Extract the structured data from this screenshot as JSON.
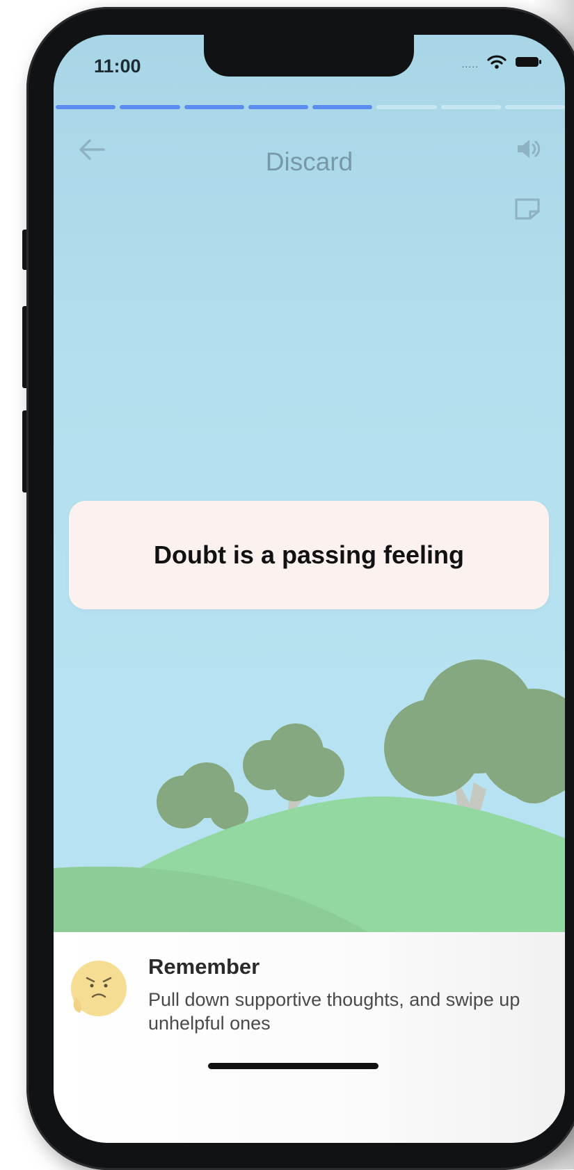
{
  "status_bar": {
    "time": "11:00",
    "signal_icon": "cellular-dots-icon",
    "wifi_icon": "wifi-icon",
    "battery_icon": "battery-icon"
  },
  "progress": {
    "total_steps": 8,
    "completed_steps": 5,
    "active_color": "#5b8df0",
    "inactive_color": "#c9e7f3"
  },
  "header": {
    "title": "Discard",
    "back_icon": "back-arrow-icon",
    "audio_icon": "speaker-icon",
    "note_icon": "note-icon"
  },
  "card": {
    "text": "Doubt is a passing feeling"
  },
  "remember": {
    "title": "Remember",
    "body": "Pull down supportive thoughts, and swipe up unhelpful ones",
    "avatar_icon": "worried-face-avatar"
  },
  "colors": {
    "sky": "#b7e2f1",
    "hill_back": "#8fd59a",
    "hill_front": "#94d99f",
    "tree": "#86a880",
    "trunk": "#c6c9bf",
    "card_bg": "#fbf1ef"
  }
}
